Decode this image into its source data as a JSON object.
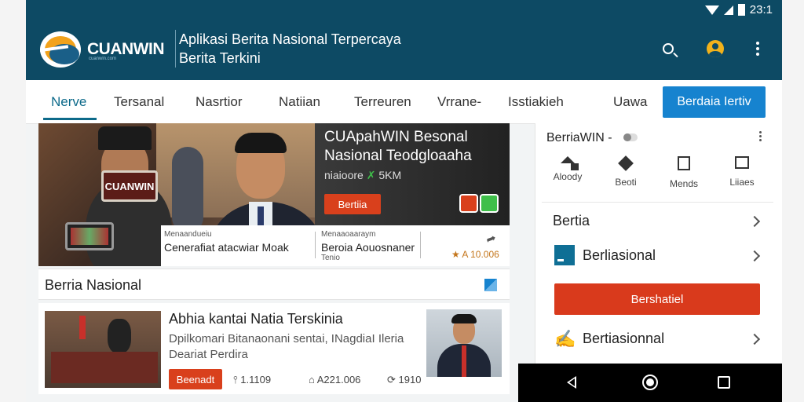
{
  "status": {
    "time": "23:1"
  },
  "header": {
    "brand": "CUANWIN",
    "brand_tagline": "cuanwin.com",
    "title_line1": "Aplikasi Berita Nasional Terpercaya",
    "title_line2": "Berita Terkini"
  },
  "tabs": {
    "items": [
      "Nerve",
      "Tersanal",
      "Nasrtior",
      "Natiian",
      "Terreuren",
      "Vrrane-",
      "Isstiakieh",
      "Uawa"
    ],
    "cta": "Berdaia Iertiv"
  },
  "hero": {
    "sign": "CUANWIN",
    "headline_line1": "CUApahWIN Besonal",
    "headline_line2": "Nasional Teodgloaaha",
    "meta": "niaioore",
    "meta_count": "5KM",
    "button": "Bertiia",
    "strip": {
      "col1_top": "Menaandueiu",
      "col1_title": "Cenerafiat atacwiar Moak",
      "col2_top": "Menaaoaaraym",
      "col2_title": "Beroia Aouosnaner",
      "col2_sub": "Tenio",
      "rating": "★ A 10.006"
    }
  },
  "section": {
    "title": "Berria Nasional"
  },
  "article": {
    "title": "Abhia kantai Natia Terskinia",
    "sub_line1": "Dpilkomari Bitanaonani sentai, INagdiaI Ileria",
    "sub_line2": "Deariat Perdira",
    "button": "Beenadt",
    "stat1": "⫯ 1.1109",
    "stat2": "⌂ A221.006",
    "stat3": "⟳ 1910"
  },
  "sidebar": {
    "header": "BerriaWIN -",
    "quick_actions": [
      "Aloody",
      "Beoti",
      "Mends",
      "Liiaes"
    ],
    "row1": "Bertia",
    "row2": "Berliasional",
    "red_button": "Bershatiel",
    "row3": "Bertiasionnal"
  },
  "icons": {
    "search": "search-icon",
    "user": "user-avatar-icon",
    "more": "more-vertical-icon"
  },
  "colors": {
    "header": "#0d4a64",
    "accent_blue": "#1683cf",
    "accent_red": "#d93a1c",
    "brand_orange": "#f2a21b"
  }
}
